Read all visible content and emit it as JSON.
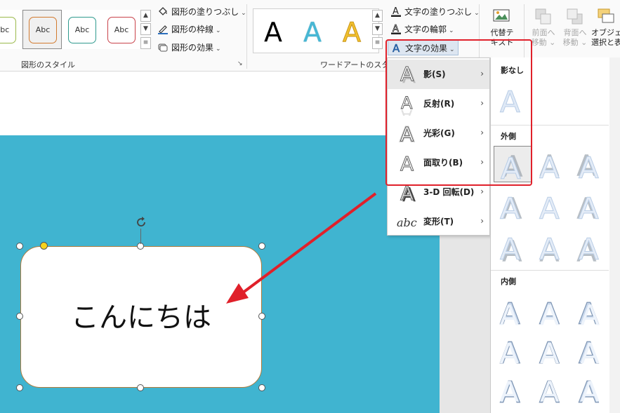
{
  "ribbon": {
    "shape_styles": {
      "group_label": "図形のスタイル",
      "thumbnails": [
        {
          "label": "Abc",
          "border_color": "#9ab94a",
          "selected": false
        },
        {
          "label": "Abc",
          "border_color": "#d27a2f",
          "selected": true
        },
        {
          "label": "Abc",
          "border_color": "#2f9a8e",
          "selected": false
        },
        {
          "label": "Abc",
          "border_color": "#c9424a",
          "selected": false
        }
      ],
      "fill_label": "図形の塗りつぶし",
      "outline_label": "図形の枠線",
      "effects_label": "図形の効果"
    },
    "wordart": {
      "group_label": "ワードアートのスタイル",
      "thumbnails": [
        {
          "label": "A",
          "color": "#000000"
        },
        {
          "label": "A",
          "color": "#47b7d4"
        },
        {
          "label": "A",
          "color": "#f2c12e"
        }
      ],
      "text_fill_label": "文字の塗りつぶし",
      "text_outline_label": "文字の輪郭",
      "text_effects_label": "文字の効果"
    },
    "alt_text_label_line1": "代替テ",
    "alt_text_label_line2": "キスト",
    "bring_forward_line1": "前面へ",
    "bring_forward_line2": "移動",
    "send_backward_line1": "背面へ",
    "send_backward_line2": "移動",
    "selection_pane_line1": "オブジェク",
    "selection_pane_line2": "選択と表"
  },
  "slide": {
    "shape_text": "こんにちは",
    "background_color": "#40b4d0"
  },
  "effect_menu": {
    "items": [
      {
        "label": "影(S)",
        "icon": "shadow-a-icon",
        "active": true
      },
      {
        "label": "反射(R)",
        "icon": "reflection-a-icon",
        "active": false
      },
      {
        "label": "光彩(G)",
        "icon": "glow-a-icon",
        "active": false
      },
      {
        "label": "面取り(B)",
        "icon": "bevel-a-icon",
        "active": false
      },
      {
        "label": "3-D 回転(D)",
        "icon": "rotation-3d-a-icon",
        "active": false
      },
      {
        "label": "変形(T)",
        "icon": "transform-abc-icon",
        "active": false
      }
    ],
    "arrow": "›"
  },
  "shadow_panel": {
    "no_shadow_heading": "影なし",
    "outer_heading": "外側",
    "inner_heading": "内側",
    "glyph": "A"
  },
  "colors": {
    "highlight": "#e0202a",
    "arrow": "#e0202a",
    "accent_blue": "#2b6fbd"
  }
}
